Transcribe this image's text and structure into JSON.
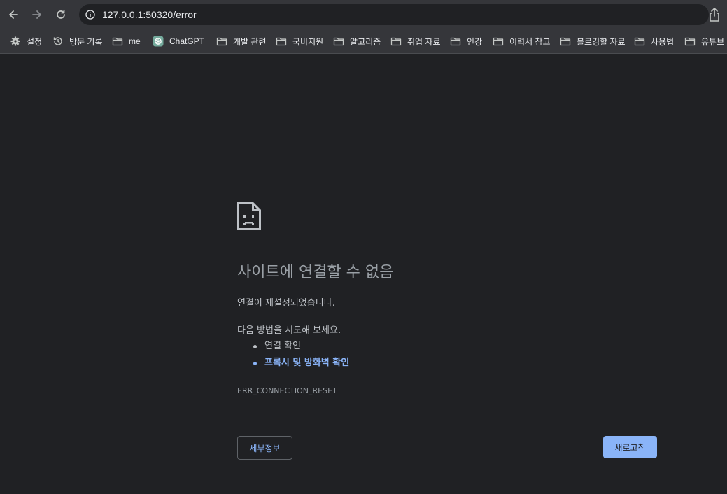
{
  "toolbar": {
    "url": "127.0.0.1:50320/error",
    "back_icon": "back-arrow-icon",
    "forward_icon": "forward-arrow-icon",
    "reload_icon": "reload-icon",
    "info_icon": "info-icon",
    "share_icon": "share-icon"
  },
  "bookmarks": [
    {
      "label": "설정",
      "icon": "gear-icon"
    },
    {
      "label": "방문 기록",
      "icon": "history-icon"
    },
    {
      "label": "me",
      "icon": "folder-icon"
    },
    {
      "label": "ChatGPT",
      "icon": "chatgpt-icon"
    },
    {
      "label": "개발 관련",
      "icon": "folder-icon"
    },
    {
      "label": "국비지원",
      "icon": "folder-icon"
    },
    {
      "label": "알고리즘",
      "icon": "folder-icon"
    },
    {
      "label": "취업 자료",
      "icon": "folder-icon"
    },
    {
      "label": "인강",
      "icon": "folder-icon"
    },
    {
      "label": "이력서 참고",
      "icon": "folder-icon"
    },
    {
      "label": "블로깅할 자료",
      "icon": "folder-icon"
    },
    {
      "label": "사용법",
      "icon": "folder-icon"
    },
    {
      "label": "유튜브",
      "icon": "folder-icon"
    }
  ],
  "error": {
    "icon": "sad-page-icon",
    "title": "사이트에 연결할 수 없음",
    "description": "연결이 재설정되었습니다.",
    "suggest_heading": "다음 방법을 시도해 보세요.",
    "suggestions": [
      {
        "label": "연결 확인",
        "link": false
      },
      {
        "label": "프록시 및 방화벽 확인",
        "link": true
      }
    ],
    "code": "ERR_CONNECTION_RESET",
    "details_label": "세부정보",
    "reload_label": "새로고침"
  },
  "colors": {
    "background": "#202124",
    "toolbar": "#35363a",
    "link": "#8ab4f8",
    "title": "#9aa0a6"
  }
}
